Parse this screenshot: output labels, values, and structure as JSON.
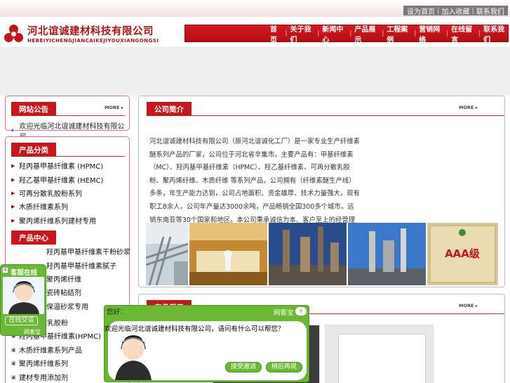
{
  "top_links": [
    "设为首页",
    "加入收藏",
    "联系我们"
  ],
  "logo": {
    "cn": "河北谊诚建材科技有限公司",
    "en": "HEBEIYICHENGJIANCAIKEJIYOUXIANGONGSI"
  },
  "nav": [
    "首页",
    "关于我们",
    "新闻中心",
    "产品展示",
    "工程案例",
    "营销网络",
    "在线留言",
    "联系我们"
  ],
  "notice": {
    "title": "网站公告",
    "more": "MORE ▸",
    "item": "欢迎光临河北谊诚建材科技有限公司"
  },
  "categories": {
    "title": "产品分类",
    "items": [
      "羟丙基甲基纤维素 (HPMC)",
      "羟乙基甲基纤维素 (HEMC)",
      "可再分散乳胶粉系列",
      "木质纤维素系列",
      "聚丙烯纤维系列建材专用"
    ],
    "sub_title": "产品中心",
    "sub_items": [
      "羟丙基甲基纤维素干粉砂浆",
      "羟丙基甲基纤维素腻子",
      "聚丙烯纤维",
      "瓷砖粘结剂",
      "保温砂浆专用"
    ],
    "more_items": [
      "可再分散乳胶粉",
      "羟丙基甲基纤维素(HPMC)",
      "木质纤维素系列产品",
      "聚丙烯纤维系列",
      "建材专用添加剂"
    ]
  },
  "about": {
    "title": "公司简介",
    "more": "MORE ▸",
    "text": "河北谊诚建材科技有限公司（原河北谊诚化工厂）是一家专业生产纤维素醚系列产品的厂家，公司位于河北省辛集市，主要产品有：甲基纤维素（MC）、羟丙基甲基纤维素（HPMC）、羟乙基纤维素、可再分散乳胶粉、聚丙烯纤维、木质纤维 等系列产品，公司拥有（纤维素醚生产线）多条，年生产能力达到，公司占地面积、资金雄厚、技术力量强大，现有职工8余人，公司年产量达3000余吨，产品畅销全国300多个城市，远销东南亚等30个国家和地区。本公司秉承诚信为本、客户至上的经营理念，竭诚为广大客户服务。"
  },
  "products": {
    "title": "产品展示",
    "more": "MORE ▸"
  },
  "photo_labels": [
    "pipeline",
    "lab",
    "refinery",
    "refinery",
    "AAA级"
  ],
  "kefu": {
    "title": "客服在线",
    "button": "在线交谈",
    "footer": "网客宝"
  },
  "chat": {
    "title": "您好：",
    "brand": "网客宝",
    "message": "欢迎光临河北谊诚建材科技有限公司，请问有什么可以帮您？",
    "accept": "接受邀请",
    "later": "稍后再说"
  }
}
